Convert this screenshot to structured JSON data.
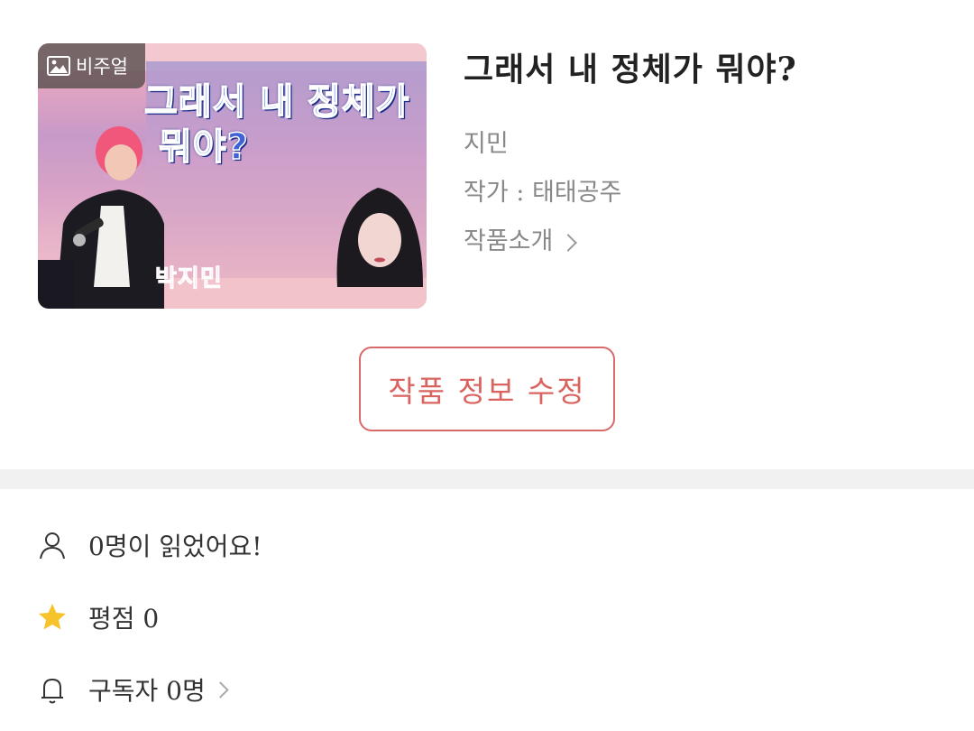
{
  "thumbnail": {
    "badge_label": "비주얼",
    "headline_line1": "그래서 내 정체가",
    "headline_line2": "뭐야?",
    "caption_name": "박지민"
  },
  "work": {
    "title": "그래서 내 정체가 뭐야?",
    "creator": "지민",
    "author": "작가 : 태태공주",
    "intro_link": "작품소개"
  },
  "actions": {
    "edit_label": "작품 정보 수정"
  },
  "stats": {
    "readers": "0명이 읽었어요!",
    "rating": "평점 0",
    "subscribers": "구독자 0명"
  },
  "colors": {
    "accent": "#d9645f",
    "star": "#f6c32c",
    "muted_text": "#888888"
  },
  "icons": {
    "badge": "image-icon",
    "readers": "person-icon",
    "rating": "star-icon",
    "subscribers": "bell-icon"
  }
}
